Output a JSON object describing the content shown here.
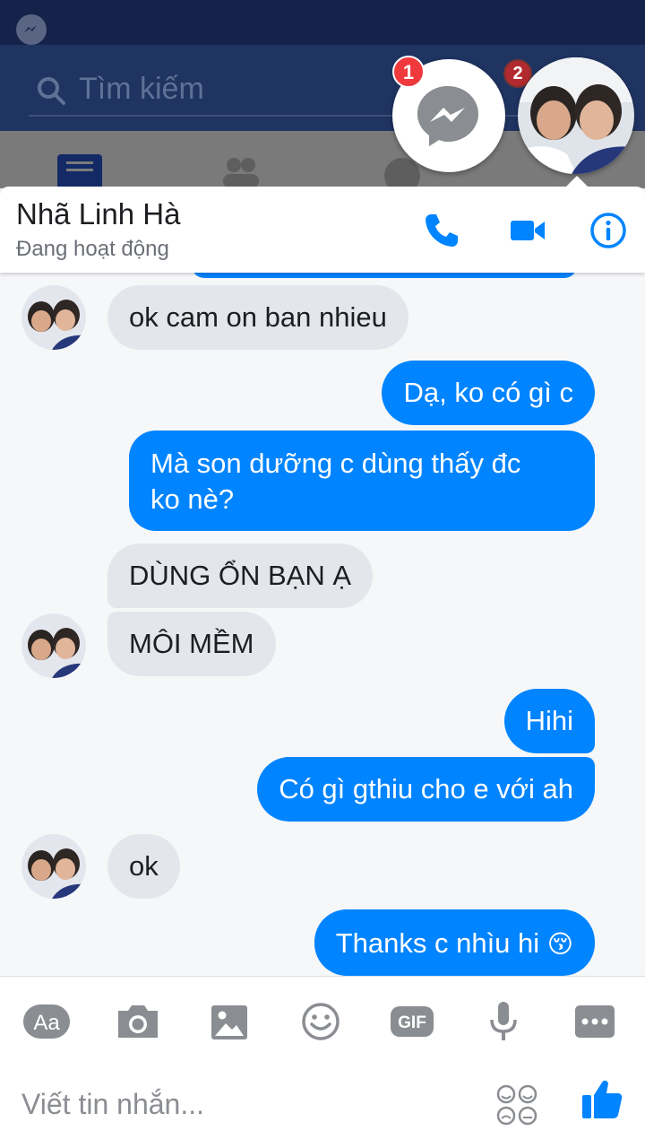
{
  "background_app": {
    "search_placeholder": "Tìm kiếm",
    "messenger_badge": "1",
    "notification_badge": "2"
  },
  "chat": {
    "contact_name": "Nhã Linh Hà",
    "contact_status": "Đang hoạt động",
    "messages": [
      {
        "from": "them",
        "text": "ok cam on ban nhieu"
      },
      {
        "from": "me",
        "text": "Dạ, ko có gì c"
      },
      {
        "from": "me",
        "line1": "Mà son dưỡng c dùng thấy đc",
        "line2": "ko nè?"
      },
      {
        "from": "them",
        "text": "DÙNG ỔN BẠN Ạ"
      },
      {
        "from": "them",
        "text": "MÔI MỀM"
      },
      {
        "from": "me",
        "text": "Hihi"
      },
      {
        "from": "me",
        "text": "Có gì gthiu cho e với ah"
      },
      {
        "from": "them",
        "text": "ok"
      },
      {
        "from": "me",
        "text": "Thanks c nhìu hi",
        "emoji": "😚"
      }
    ]
  },
  "composer": {
    "aa_label": "Aa",
    "gif_label": "GIF",
    "placeholder": "Viết tin nhắn..."
  },
  "colors": {
    "accent": "#0084ff",
    "incoming_bubble": "#e4e6eb",
    "badge": "#f0393d"
  }
}
